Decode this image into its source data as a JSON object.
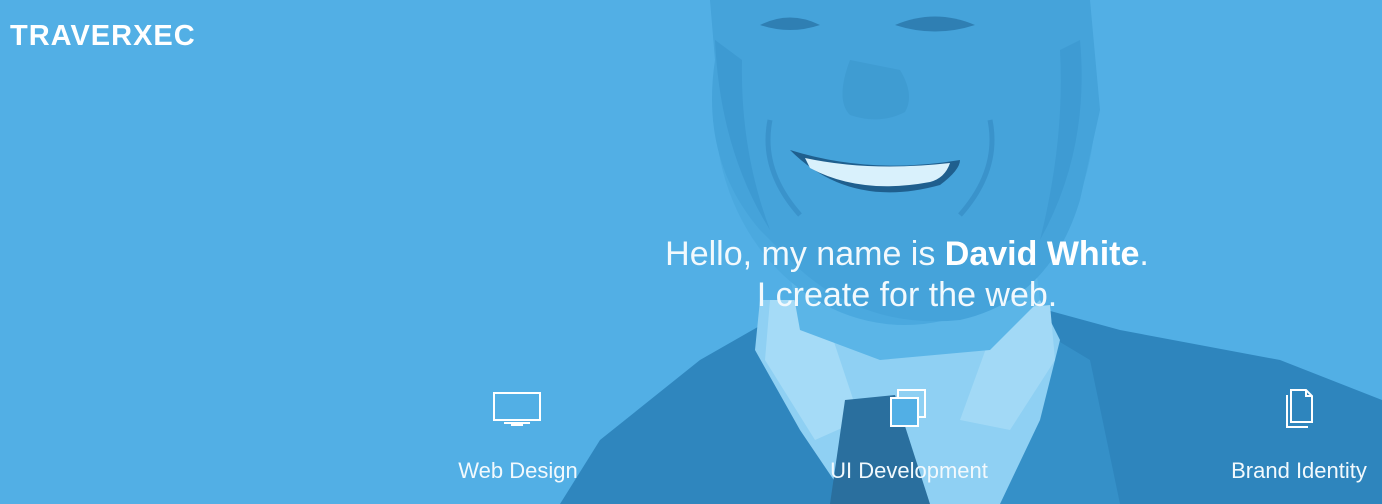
{
  "brand": {
    "logo": "TRAVERXEC"
  },
  "hero": {
    "greeting_prefix": "Hello, my name is ",
    "name": "David White",
    "greeting_suffix": ".",
    "tagline": "I create for the web.",
    "background_color": "#52afe5"
  },
  "services": [
    {
      "label": "Web Design",
      "icon": "monitor-icon"
    },
    {
      "label": "UI Development",
      "icon": "stacked-windows-icon"
    },
    {
      "label": "Brand Identity",
      "icon": "documents-icon"
    }
  ]
}
